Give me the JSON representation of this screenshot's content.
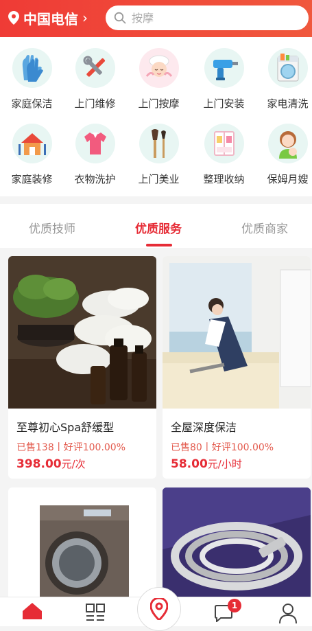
{
  "header": {
    "location_label": "中国电信",
    "location_arrow": "›",
    "search_placeholder": "按摩"
  },
  "categories": [
    {
      "label": "家庭保洁",
      "icon": "cleaning-gloves-icon"
    },
    {
      "label": "上门维修",
      "icon": "tools-icon"
    },
    {
      "label": "上门按摩",
      "icon": "massage-icon"
    },
    {
      "label": "上门安装",
      "icon": "drill-icon"
    },
    {
      "label": "家电清洗",
      "icon": "washing-machine-icon"
    },
    {
      "label": "家庭装修",
      "icon": "house-renovation-icon"
    },
    {
      "label": "衣物洗护",
      "icon": "shirt-icon"
    },
    {
      "label": "上门美业",
      "icon": "makeup-brush-icon"
    },
    {
      "label": "整理收纳",
      "icon": "wardrobe-icon"
    },
    {
      "label": "保姆月嫂",
      "icon": "nanny-icon"
    }
  ],
  "tabs": [
    {
      "label": "优质技师",
      "active": false
    },
    {
      "label": "优质服务",
      "active": true
    },
    {
      "label": "优质商家",
      "active": false
    }
  ],
  "services": [
    {
      "title": "至尊初心Spa舒缓型",
      "stats": "已售138丨好评100.00%",
      "price": "398.00",
      "unit": "元/次"
    },
    {
      "title": "全屋深度保洁",
      "stats": "已售80丨好评100.00%",
      "price": "58.00",
      "unit": "元/小时"
    }
  ],
  "tabbar": {
    "items": [
      "home-icon",
      "category-grid-icon",
      "location-pin-icon",
      "message-icon",
      "profile-icon"
    ],
    "message_badge": "1"
  },
  "colors": {
    "brand_red": "#e62c36",
    "header_gradient_start": "#ef3b36",
    "stats_color": "#e35a4d"
  }
}
